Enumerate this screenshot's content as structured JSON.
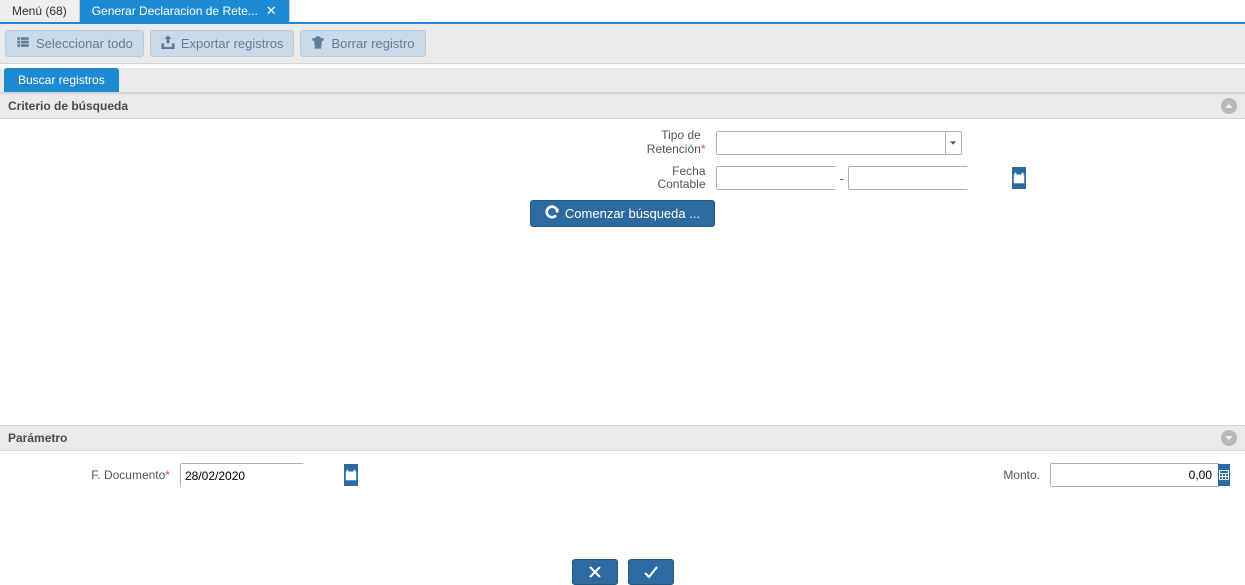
{
  "tabs": {
    "menu_label": "Menú (68)",
    "active_label": "Generar Declaracion de Rete..."
  },
  "toolbar": {
    "select_all": "Seleccionar todo",
    "export": "Exportar registros",
    "delete": "Borrar registro"
  },
  "subtab": {
    "search_label": "Buscar registros"
  },
  "criteria": {
    "header": "Criterio de búsqueda",
    "tipo_retencion_label": "Tipo de\nRetención",
    "tipo_retencion_value": "",
    "fecha_contable_label": "Fecha\nContable",
    "fecha_from": "",
    "fecha_to": "",
    "search_button": "Comenzar búsqueda ..."
  },
  "parametro": {
    "header": "Parámetro",
    "fdocumento_label": "F. Documento",
    "fdocumento_value": "28/02/2020",
    "monto_label": "Monto.",
    "monto_value": "0,00"
  },
  "colors": {
    "primary": "#1e8ad4",
    "toolbar_btn": "#c9dbea",
    "dark_btn": "#2c6aa0"
  }
}
